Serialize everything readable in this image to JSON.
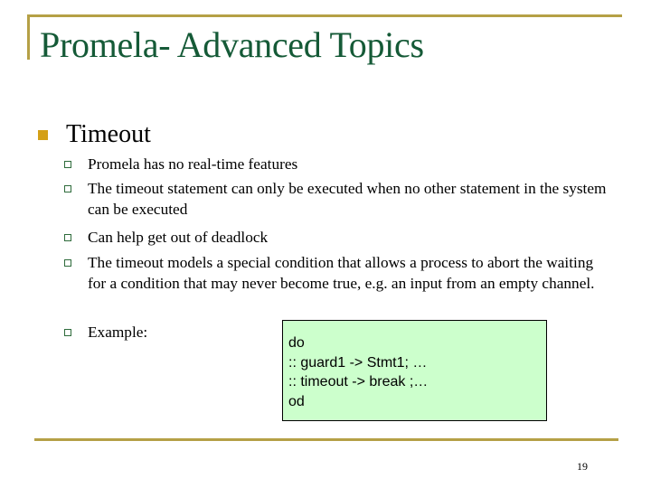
{
  "slide": {
    "title": "Promela- Advanced Topics",
    "page_number": "19",
    "accent_colors": {
      "rule": "#b5a046",
      "title": "#155a37",
      "level1_bullet": "#d4a017",
      "level2_bullet": "#2e6b3b",
      "code_box_bg": "#ccffcc"
    }
  },
  "content": {
    "heading": "Timeout",
    "bullets": [
      {
        "text": "Promela has no real-time features"
      },
      {
        "text": "The timeout statement can only be executed when no other statement in the system can be executed"
      },
      {
        "text": "Can help get out of deadlock"
      },
      {
        "text": "The timeout models a special condition that allows a process to abort the waiting for a condition that may never become true, e.g. an input from an empty channel."
      },
      {
        "text": "Example:"
      }
    ]
  },
  "code_example": {
    "lines": [
      "do",
      ":: guard1 -> Stmt1; …",
      ":: timeout -> break ;…",
      "od"
    ]
  }
}
